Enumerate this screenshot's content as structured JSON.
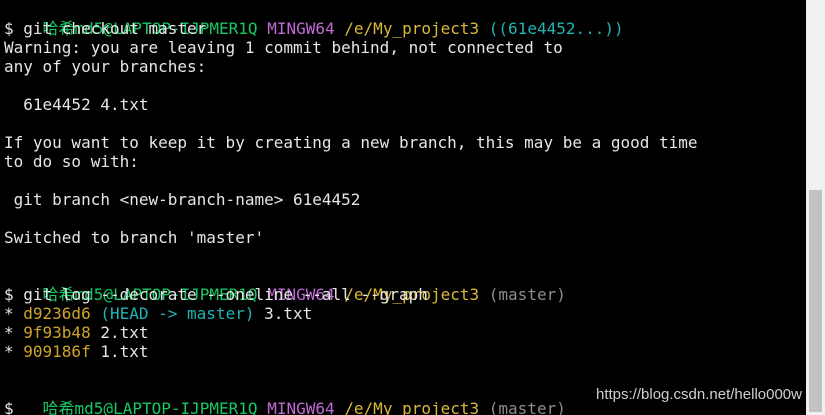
{
  "prompt1": {
    "user": "哈希md5@LAPTOP-IJPMER1Q",
    "system": "MINGW64",
    "path": "/e/My_project3",
    "branch": "((61e4452...))"
  },
  "cmd1": "$ git checkout master",
  "output1": {
    "line1": "Warning: you are leaving 1 commit behind, not connected to",
    "line2": "any of your branches:",
    "line3": "  61e4452 4.txt",
    "line4": "If you want to keep it by creating a new branch, this may be a good time",
    "line5": "to do so with:",
    "line6": " git branch <new-branch-name> 61e4452",
    "line7": "Switched to branch 'master'"
  },
  "prompt2": {
    "user": "哈希md5@LAPTOP-IJPMER1Q",
    "system": "MINGW64",
    "path": "/e/My_project3",
    "branch": "(master)"
  },
  "cmd2": "$ git log --decorate --oneline --all --graph",
  "log": [
    {
      "graph": "* ",
      "hash": "d9236d6",
      "ref": "(HEAD -> master)",
      "msg": " 3.txt"
    },
    {
      "graph": "* ",
      "hash": "9f93b48",
      "ref": "",
      "msg": " 2.txt"
    },
    {
      "graph": "* ",
      "hash": "909186f",
      "ref": "",
      "msg": " 1.txt"
    }
  ],
  "prompt3": {
    "user": "哈希md5@LAPTOP-IJPMER1Q",
    "system": "MINGW64",
    "path": "/e/My_project3",
    "branch": "(master)"
  },
  "cursor_prompt": "$",
  "watermark": "https://blog.csdn.net/hello000w",
  "colors": {
    "background": "#000000",
    "user": "#17c964",
    "system": "#c06ad6",
    "path": "#d9b93a",
    "branch": "#21b3b3"
  }
}
